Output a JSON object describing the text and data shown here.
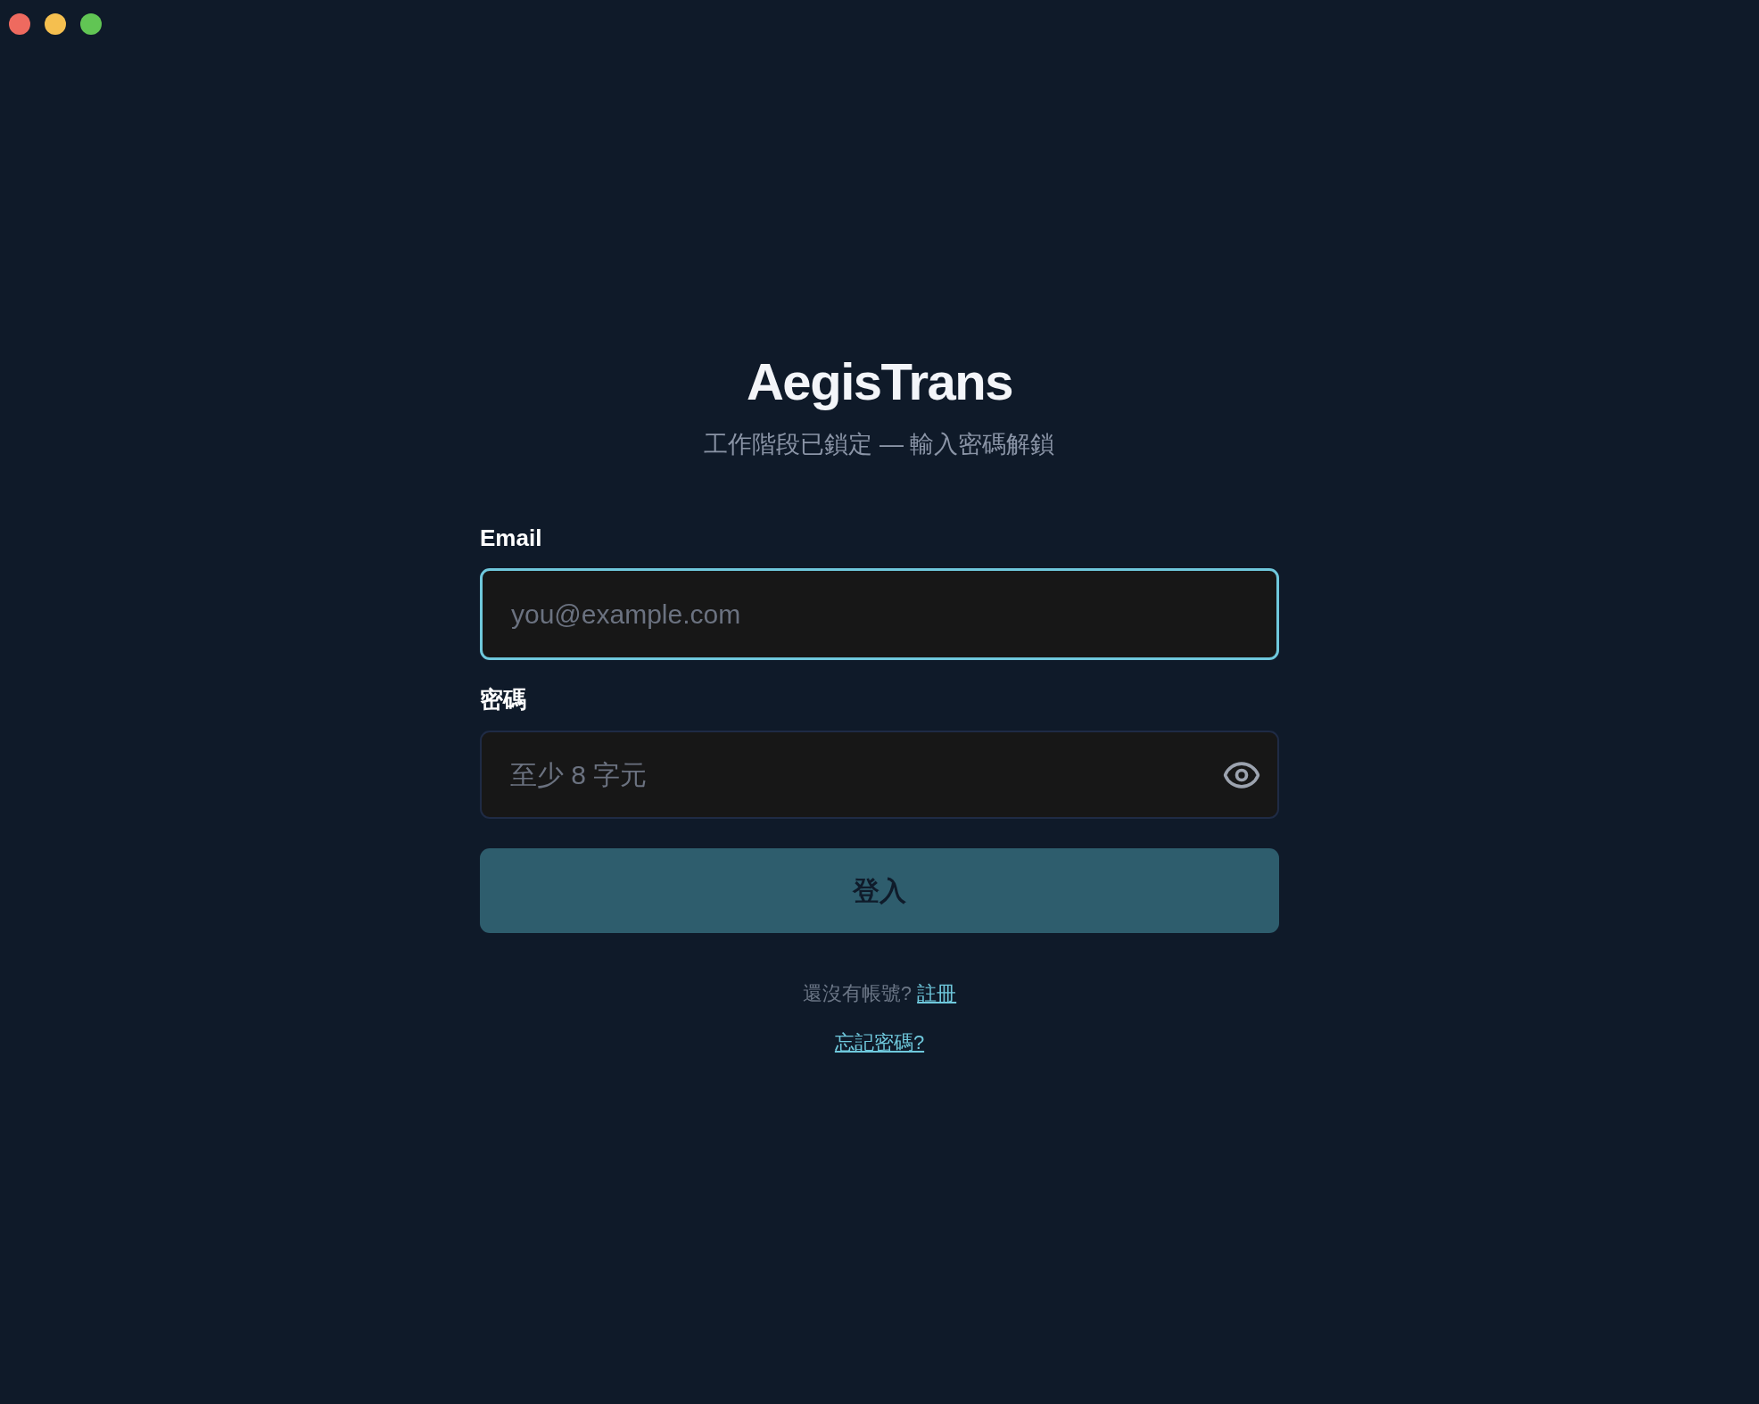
{
  "window": {
    "controls": [
      {
        "color": "#ee6a5f"
      },
      {
        "color": "#f5bf4f"
      },
      {
        "color": "#61c554"
      }
    ]
  },
  "header": {
    "title": "AegisTrans",
    "subtitle": "工作階段已鎖定 — 輸入密碼解鎖"
  },
  "form": {
    "fields": [
      {
        "kind": "email",
        "label": "Email",
        "placeholder": "you@example.com",
        "focused": true
      },
      {
        "kind": "password",
        "label": "密碼",
        "placeholder": "至少 8 字元",
        "focused": false
      }
    ],
    "submit": {
      "label": "登入",
      "disabled": true
    }
  },
  "footer": {
    "signup_prompt": "還沒有帳號?",
    "signup_link": "註冊",
    "forgot_link": "忘記密碼?"
  }
}
